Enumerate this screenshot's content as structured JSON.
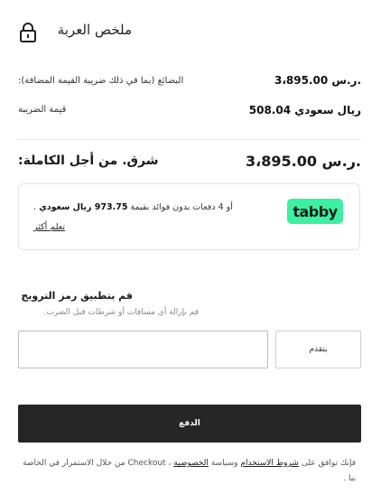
{
  "header": {
    "title": "ملخص العربة",
    "icon": "lock-icon"
  },
  "summary": {
    "goods_label": "البضائع (بما في ذلك ضريبة القيمة المضافة):",
    "goods_value": "3،895.00 ر.س.",
    "tax_label": "قيمة الضريبة",
    "tax_value": "508.04 ريال سعودي",
    "total_label": "شرق. من أجل الكاملة:",
    "total_value": "3،895.00 ر.س."
  },
  "tabby": {
    "logo": "tabby",
    "text_prefix": "أو 4 دفعات بدون فوائد بقيمة",
    "amount": "973.75 ريال سعودي",
    "text_suffix": ".",
    "learn_more": "تعلم أكثر",
    "logo_color": "#3bf0a0"
  },
  "promo": {
    "title": "قم بتطبيق رمز الترويج",
    "subtitle": "قم بإزالة أي مسافات أو شرطات قبل الضرب.",
    "input_value": "",
    "apply_label": "يتقدم"
  },
  "pay": {
    "label": "الدفع"
  },
  "legal": {
    "prefix": "فإنك توافق على",
    "terms": "شروط الاستخدام",
    "and": "وسياسة",
    "privacy": "الخصوصية",
    "suffix": "، Checkout من خلال الاستمرار في الخاصة بنا ."
  },
  "colors": {
    "pay_button_bg": "#262626",
    "divider": "#e6e6e6"
  }
}
